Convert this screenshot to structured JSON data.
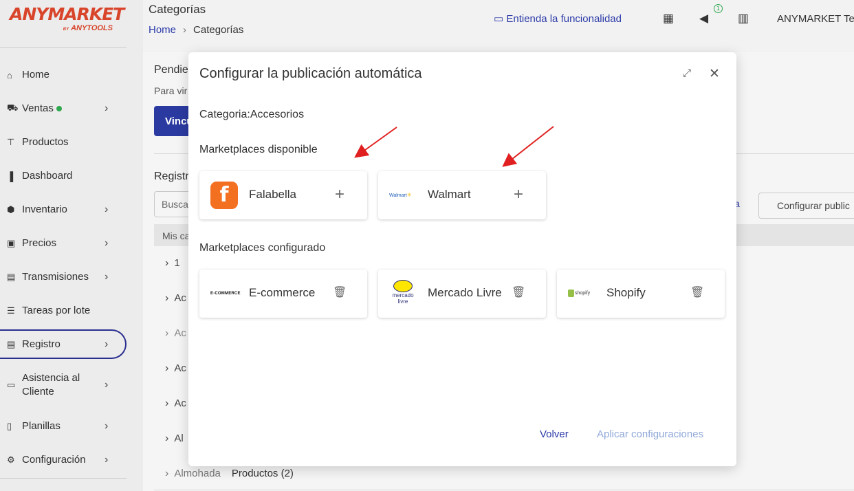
{
  "sidebar": {
    "logo_main": "ANYMARKET",
    "logo_by": "BY",
    "logo_sub": "ANYTOOLS",
    "items": [
      {
        "label": "Home",
        "icon": "home-icon",
        "glyph": "⌂"
      },
      {
        "label": "Ventas",
        "icon": "cart-icon",
        "glyph": "🛒"
      },
      {
        "label": "Productos",
        "icon": "shirt-icon",
        "glyph": "👕"
      },
      {
        "label": "Dashboard",
        "icon": "bar-chart-icon",
        "glyph": "▐"
      },
      {
        "label": "Inventario",
        "icon": "box-icon",
        "glyph": "⬢"
      },
      {
        "label": "Precios",
        "icon": "money-icon",
        "glyph": "▣"
      },
      {
        "label": "Transmisiones",
        "icon": "store-icon",
        "glyph": "▤"
      },
      {
        "label": "Tareas por lote",
        "icon": "list-icon",
        "glyph": "☰"
      },
      {
        "label": "Registro",
        "icon": "clipboard-icon",
        "glyph": "▤"
      },
      {
        "label": "Asistencia al Cliente",
        "label_line1": "Asistencia al",
        "label_line2": "Cliente",
        "icon": "chat-icon",
        "glyph": "▭"
      },
      {
        "label": "Planillas",
        "icon": "spreadsheet-icon",
        "glyph": "▯"
      },
      {
        "label": "Configuración",
        "icon": "gear-icon",
        "glyph": "⚙"
      }
    ]
  },
  "header": {
    "title": "Categorías",
    "breadcrumb_home": "Home",
    "breadcrumb_sep": "›",
    "breadcrumb_current": "Categorías",
    "help_link": "Entienda la funcionalidad",
    "notification_count": "1",
    "account": "ANYMARKET Tes"
  },
  "background": {
    "pending_title": "Pendie",
    "pending_text": "Para vir",
    "link_button": "Vincu",
    "registry_title": "Registr",
    "search_placeholder": "Busca",
    "link_fragment": "a",
    "config_button": "Configurar public",
    "table_head": "Mis ca",
    "rows": [
      {
        "text": "1"
      },
      {
        "text": "Ac"
      },
      {
        "text": "Ac"
      },
      {
        "text": "Ac"
      },
      {
        "text": "Ac"
      },
      {
        "text": "Al"
      }
    ],
    "last_row_name": "Almohada",
    "last_row_count": "Productos (2)"
  },
  "modal": {
    "title": "Configurar la publicación automática",
    "category": "Categoria:Accesorios",
    "available_title": "Marketplaces disponible",
    "configured_title": "Marketplaces configurado",
    "available": [
      {
        "name": "Falabella",
        "logo": "f"
      },
      {
        "name": "Walmart",
        "logo": "Walmart"
      }
    ],
    "configured": [
      {
        "name": "E-commerce",
        "logo": "E-COMMERCE"
      },
      {
        "name": "Mercado Livre",
        "logo_line1": "mercado",
        "logo_line2": "livre"
      },
      {
        "name": "Shopify",
        "logo": "shopify"
      }
    ],
    "back_button": "Volver",
    "apply_button": "Aplicar configuraciones"
  },
  "colors": {
    "brand": "#d8452b",
    "primary": "#2b3aa8",
    "falabella": "#f37021",
    "annotation_arrow": "#e02020"
  }
}
